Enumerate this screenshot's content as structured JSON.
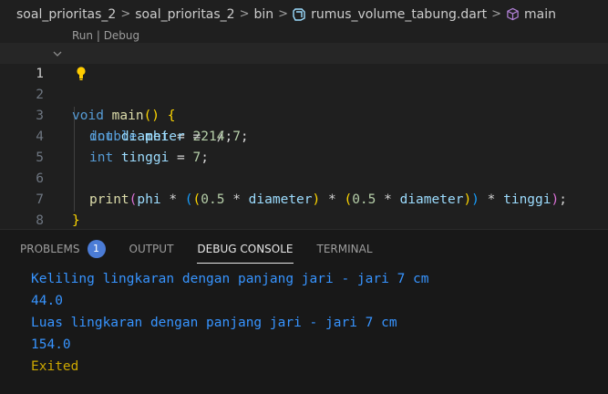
{
  "breadcrumb": {
    "items": [
      "soal_prioritas_2",
      "soal_prioritas_2",
      "bin",
      "rumus_volume_tabung.dart",
      "main"
    ],
    "separator": ">"
  },
  "codelens": {
    "run": "Run",
    "separator": " | ",
    "debug": "Debug"
  },
  "editor": {
    "line_numbers": [
      "1",
      "2",
      "3",
      "4",
      "5",
      "6",
      "7",
      "8"
    ],
    "active_line": 1,
    "lines": {
      "l1": {
        "void": "void",
        "main": "main",
        "paren": "()",
        "space": " ",
        "brace": "{"
      },
      "l2": {
        "type": "double",
        "name": " phi",
        "eq": " = ",
        "a": "22",
        "div": " / ",
        "b": "7",
        "semi": ";"
      },
      "l3": {
        "type": "int",
        "name": " diameter",
        "eq": " = ",
        "val": "14",
        "semi": ";"
      },
      "l4": {
        "type": "int",
        "name": " tinggi",
        "eq": " = ",
        "val": "7",
        "semi": ";"
      },
      "l6": {
        "print": "print",
        "p1": "(",
        "phi": "phi",
        "mul1": " * ",
        "p2": "(",
        "p3": "(",
        "half1": "0.5",
        "mul2": " * ",
        "d1": "diameter",
        "p3c": ")",
        "mul3": " * ",
        "p4": "(",
        "half2": "0.5",
        "mul4": " * ",
        "d2": "diameter",
        "p4c": ")",
        "p2c": ")",
        "mul5": " * ",
        "t": "tinggi",
        "p1c": ")",
        "semi": ";"
      },
      "l7": {
        "brace": "}"
      }
    }
  },
  "panel": {
    "tabs": [
      "PROBLEMS",
      "OUTPUT",
      "DEBUG CONSOLE",
      "TERMINAL"
    ],
    "problems_count": "1",
    "active_tab": "DEBUG CONSOLE",
    "console_lines": [
      "Keliling lingkaran dengan panjang jari - jari 7 cm",
      "44.0",
      "Luas lingkaran dengan panjang jari - jari 7 cm",
      "154.0",
      "Exited"
    ]
  },
  "colors": {
    "background": "#1f1f1f",
    "keyword": "#569cd6",
    "function": "#dcdcaa",
    "identifier": "#9cdcfe",
    "number": "#b5cea8",
    "console_output": "#3794ff",
    "exited": "#cca700",
    "badge": "#4b7cd6"
  },
  "icons": [
    "dart-icon",
    "cube-icon",
    "lightbulb-icon",
    "fold-chevron-icon"
  ]
}
